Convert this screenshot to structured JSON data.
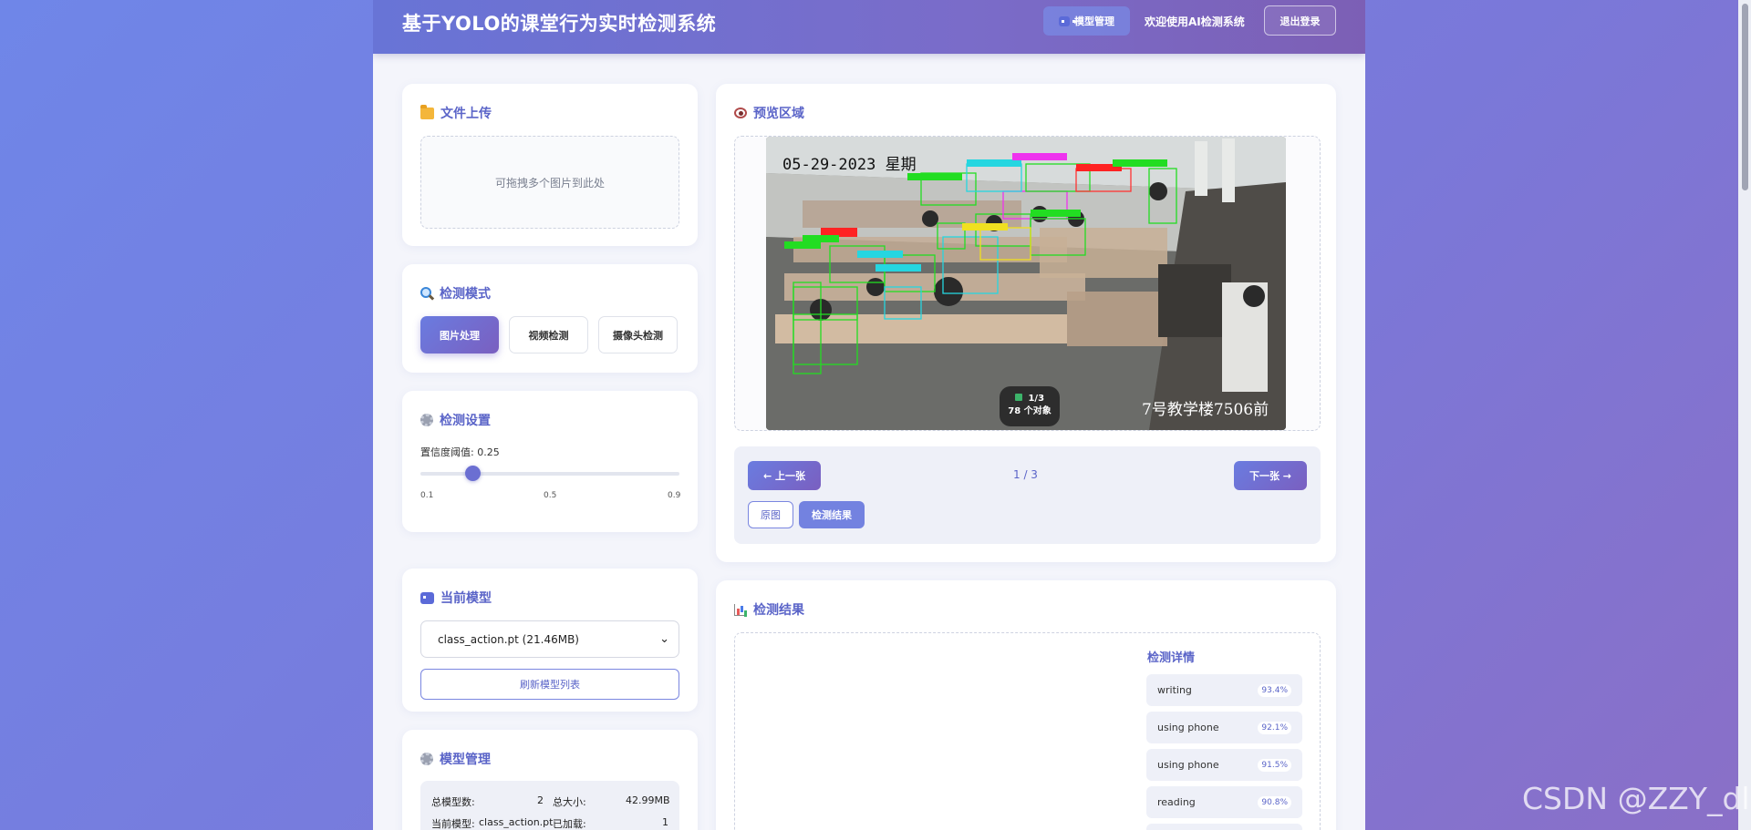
{
  "header": {
    "title": "基于YOLO的课堂行为实时检测系统",
    "model_mgmt_label": "模型管理",
    "welcome_text": "欢迎使用AI检测系统",
    "logout_label": "退出登录"
  },
  "upload": {
    "title": "文件上传",
    "dropzone_text": "可拖拽多个图片到此处"
  },
  "mode": {
    "title": "检测模式",
    "buttons": [
      {
        "label": "图片处理",
        "active": true
      },
      {
        "label": "视频检测",
        "active": false
      },
      {
        "label": "摄像头检测",
        "active": false
      }
    ]
  },
  "settings": {
    "title": "检测设置",
    "threshold_label": "置信度阈值: 0.25",
    "threshold_value": 0.25,
    "slider_min": 0.1,
    "slider_max": 0.9,
    "tick_min": "0.1",
    "tick_mid": "0.5",
    "tick_max": "0.9"
  },
  "current_model": {
    "title": "当前模型",
    "selected": "class_action.pt (21.46MB)",
    "refresh_label": "刷新模型列表"
  },
  "model_management": {
    "title": "模型管理",
    "total_models_label": "总模型数:",
    "total_models_value": "2",
    "total_size_label": "总大小:",
    "total_size_value": "42.99MB",
    "current_model_label": "当前模型:",
    "current_model_value": "class_action.pt",
    "loaded_label": "已加载:",
    "loaded_value": "1"
  },
  "preview": {
    "title": "预览区域",
    "photo_date": "05-29-2023 星期",
    "photo_caption": "7号教学楼7506前",
    "badge_line1": "1/3",
    "badge_line2": "78 个对象",
    "prev_label": "← 上一张",
    "next_label": "下一张 →",
    "page_indicator": "1 / 3",
    "original_label": "原图",
    "result_label": "检测结果"
  },
  "results": {
    "title": "检测结果",
    "details_title": "检测详情",
    "items": [
      {
        "name": "writing",
        "confidence": "93.4%"
      },
      {
        "name": "using phone",
        "confidence": "92.1%"
      },
      {
        "name": "using phone",
        "confidence": "91.5%"
      },
      {
        "name": "reading",
        "confidence": "90.8%"
      }
    ]
  },
  "watermark": "CSDN @ZZY_dl",
  "colors": {
    "accent": "#5a64c8",
    "header_start": "#6874d6",
    "header_end": "#7c5fb5",
    "button_gradient_start": "#6a7ce0",
    "button_gradient_end": "#7a5fc0"
  }
}
